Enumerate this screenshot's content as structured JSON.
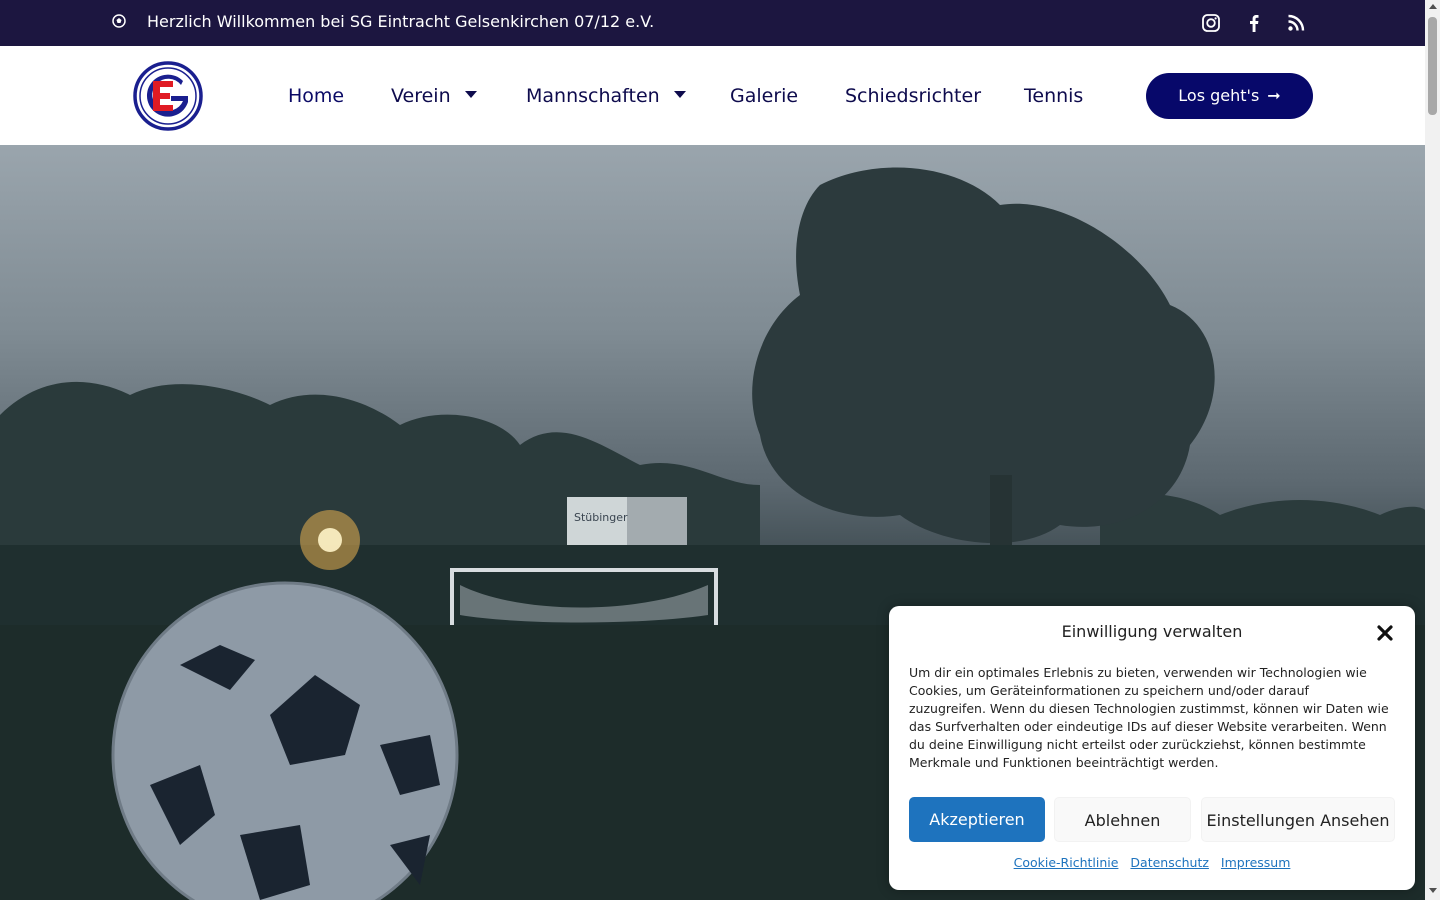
{
  "topbar": {
    "welcome": "Herzlich Willkommen bei SG Eintracht Gelsenkirchen 07/12 e.V.",
    "ball_icon": "❀",
    "social": [
      "instagram-icon",
      "facebook-icon",
      "rss-icon"
    ]
  },
  "header": {
    "nav": [
      {
        "label": "Home"
      },
      {
        "label": "Verein"
      },
      {
        "label": "Mannschaften"
      },
      {
        "label": "Galerie"
      },
      {
        "label": "Schiedsrichter"
      },
      {
        "label": "Tennis"
      }
    ],
    "cta_label": "Los geht's",
    "cta_arrow": "➞"
  },
  "hero": {
    "billboard_text": "Stübinger"
  },
  "cookie": {
    "title": "Einwilligung verwalten",
    "body": "Um dir ein optimales Erlebnis zu bieten, verwenden wir Technologien wie Cookies, um Geräteinformationen zu speichern und/oder darauf zuzugreifen. Wenn du diesen Technologien zustimmst, können wir Daten wie das Surfverhalten oder eindeutige IDs auf dieser Website verarbeiten. Wenn du deine Einwilligung nicht erteilst oder zurückziehst, können bestimmte Merkmale und Funktionen beeinträchtigt werden.",
    "accept": "Akzeptieren",
    "deny": "Ablehnen",
    "settings": "Einstellungen Ansehen",
    "links": [
      "Cookie-Richtlinie",
      "Datenschutz",
      "Impressum"
    ]
  },
  "colors": {
    "topbar_bg": "#1c1640",
    "nav_text": "#0e0b4d",
    "cta_bg": "#07086a",
    "accept_bg": "#1e73be",
    "link": "#1e73be"
  }
}
